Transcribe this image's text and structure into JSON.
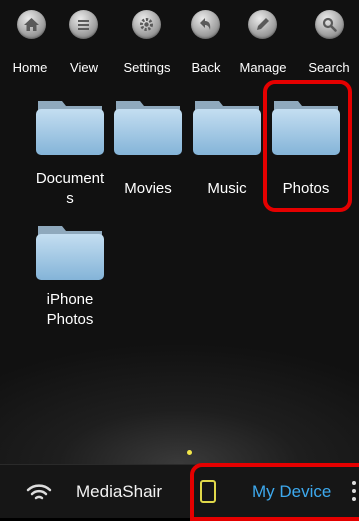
{
  "toolbar": {
    "items": [
      {
        "label": "Home",
        "icon": "home-icon"
      },
      {
        "label": "View",
        "icon": "list-icon"
      },
      {
        "label": "Settings",
        "icon": "gear-icon"
      },
      {
        "label": "Back",
        "icon": "back-arrow-icon"
      },
      {
        "label": "Manage",
        "icon": "pencil-icon"
      },
      {
        "label": "Search",
        "icon": "search-icon"
      }
    ]
  },
  "folders": [
    {
      "line1": "Document",
      "line2": "s"
    },
    {
      "line1": "Movies",
      "line2": ""
    },
    {
      "line1": "Music",
      "line2": ""
    },
    {
      "line1": "Photos",
      "line2": ""
    },
    {
      "line1": "iPhone",
      "line2": "Photos"
    }
  ],
  "bottom_bar": {
    "device_name": "MediaShair",
    "my_device": "My Device"
  },
  "colors": {
    "highlight": "#e50000",
    "folder": "#9fc8e6",
    "my_device": "#3da9ee",
    "tablet_icon": "#e0d84a"
  }
}
